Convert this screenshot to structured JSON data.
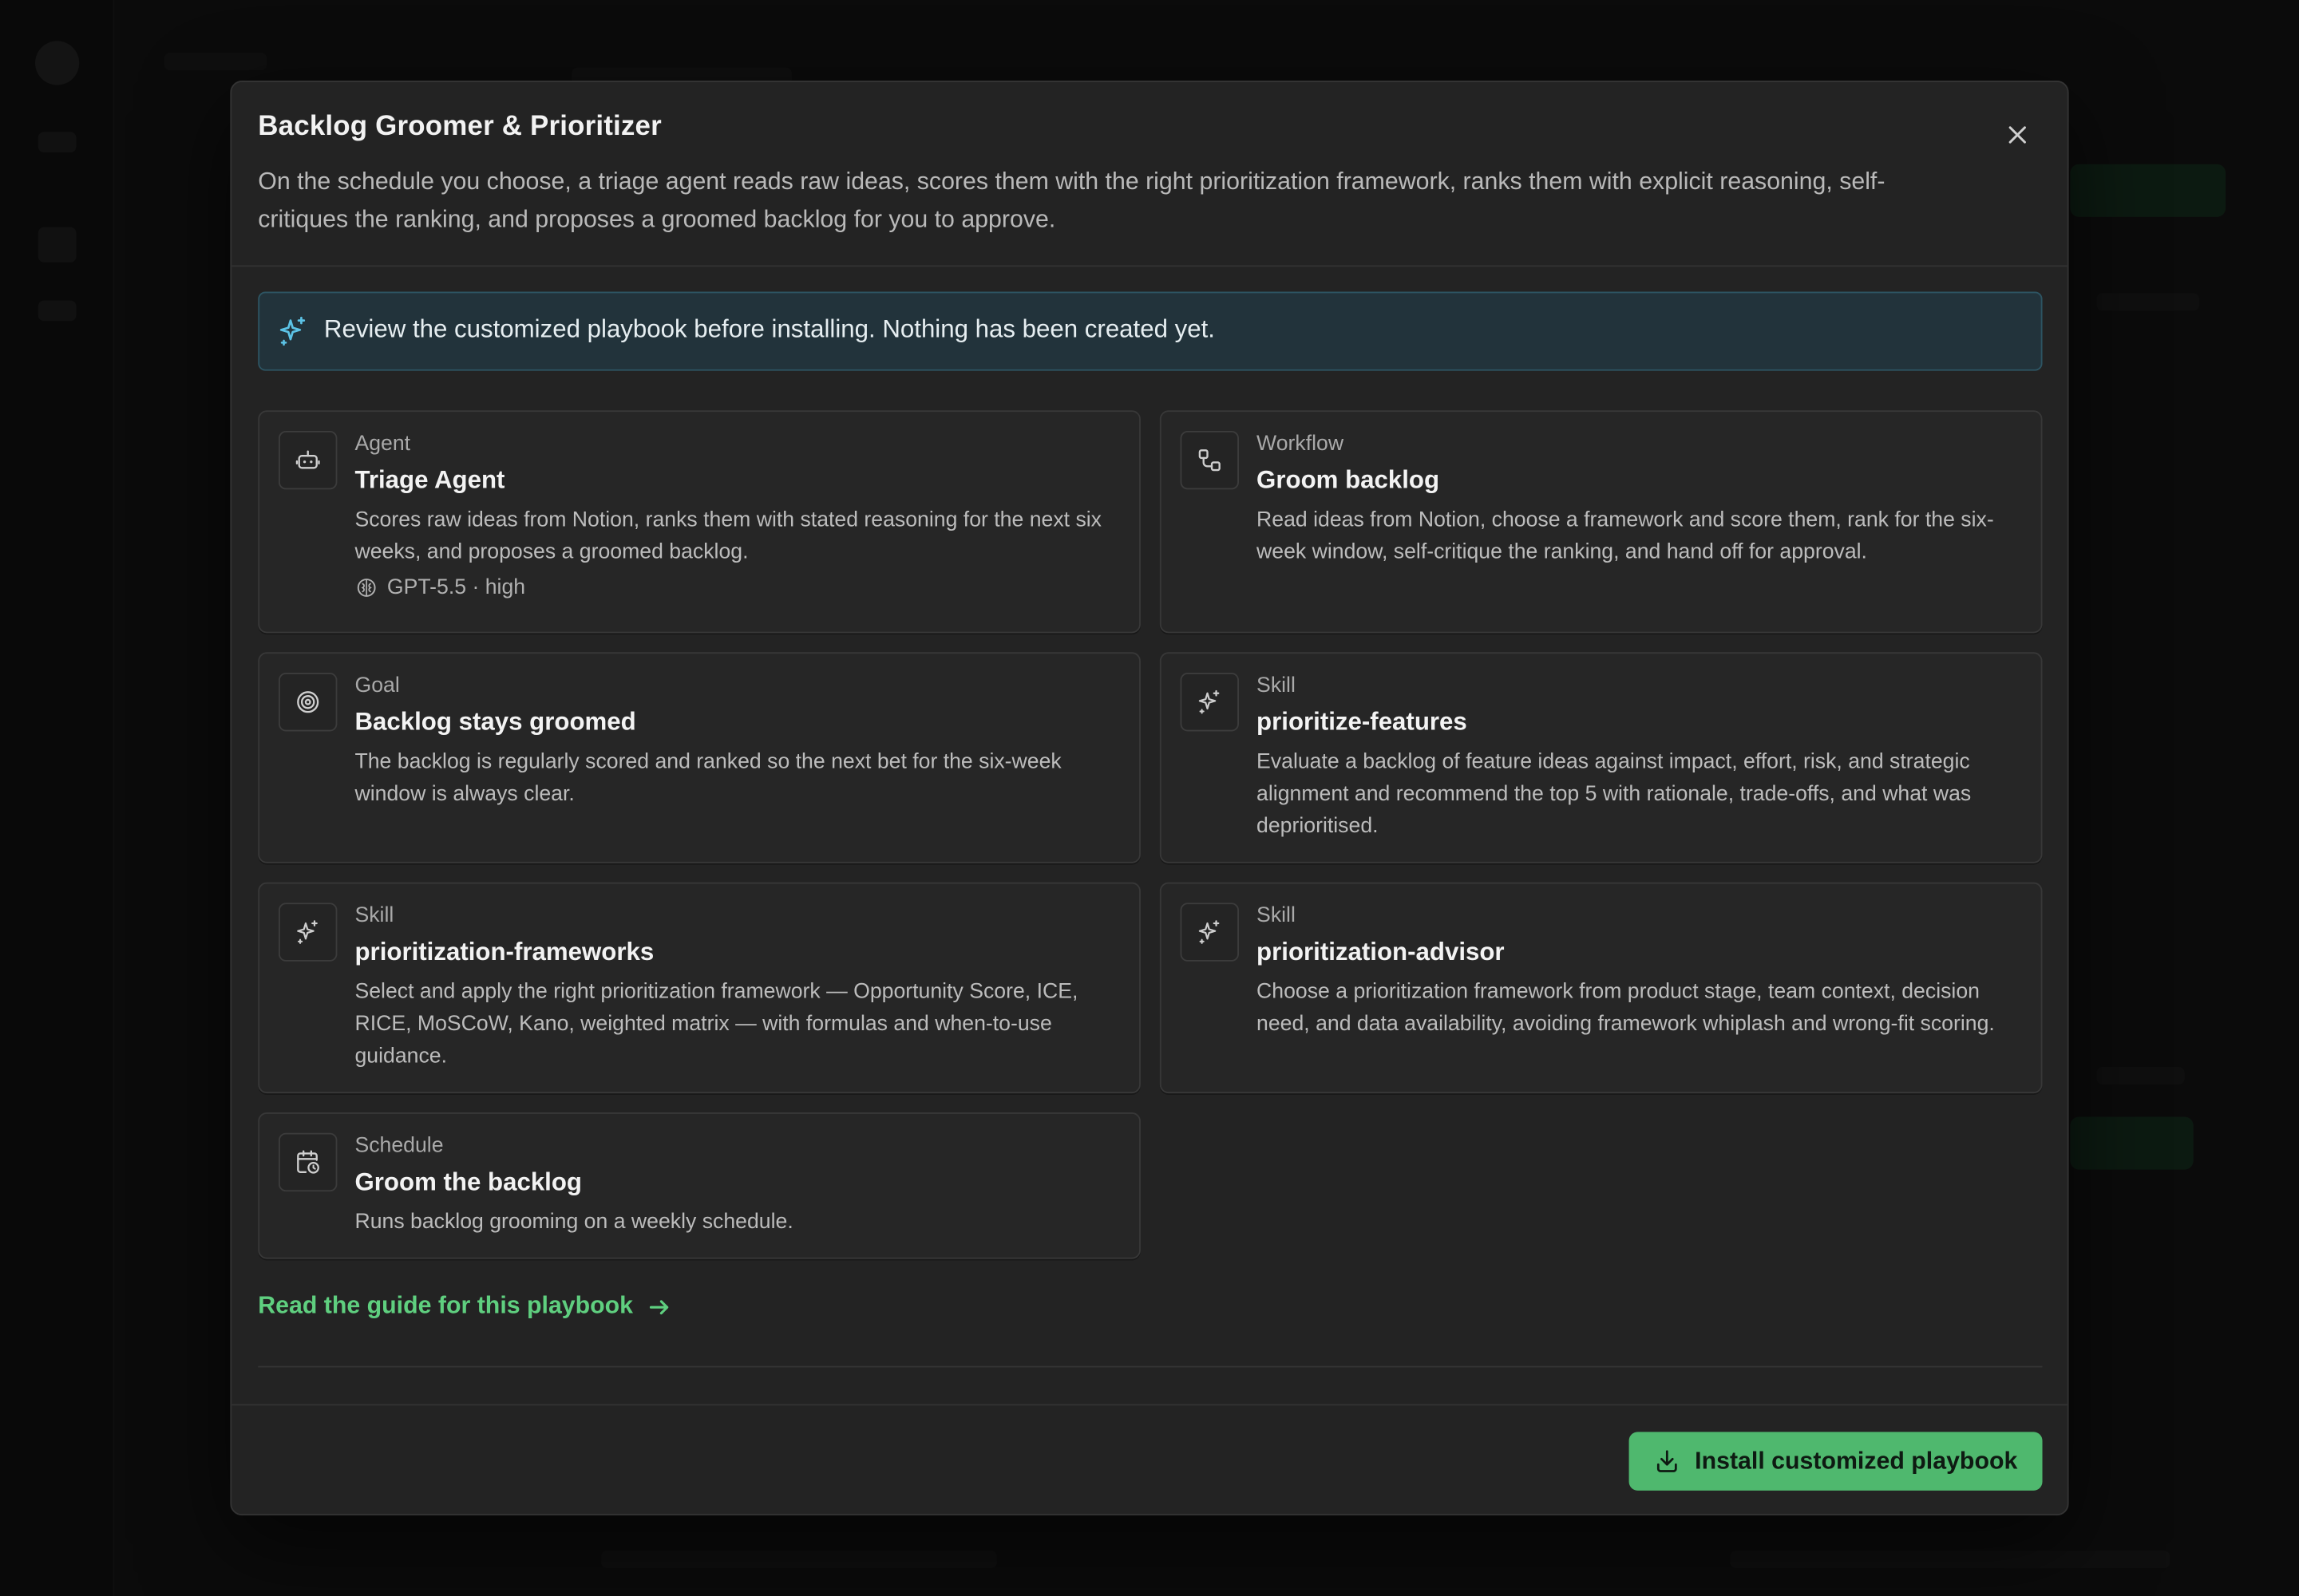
{
  "modal": {
    "title": "Backlog Groomer & Prioritizer",
    "description": "On the schedule you choose, a triage agent reads raw ideas, scores them with the right prioritization framework, ranks them with explicit reasoning, self-critiques the ranking, and proposes a groomed backlog for you to approve.",
    "close_icon": "close-icon"
  },
  "notice": {
    "icon": "sparkles-icon",
    "text": "Review the customized playbook before installing. Nothing has been created yet."
  },
  "cards": [
    {
      "kind": "Agent",
      "title": "Triage Agent",
      "description": "Scores raw ideas from Notion, ranks them with stated reasoning for the next six weeks, and proposes a groomed backlog.",
      "model": "GPT-5.5 · high",
      "icon": "robot-icon"
    },
    {
      "kind": "Workflow",
      "title": "Groom backlog",
      "description": "Read ideas from Notion, choose a framework and score them, rank for the six-week window, self-critique the ranking, and hand off for approval.",
      "icon": "workflow-icon"
    },
    {
      "kind": "Goal",
      "title": "Backlog stays groomed",
      "description": "The backlog is regularly scored and ranked so the next bet for the six-week window is always clear.",
      "icon": "target-icon"
    },
    {
      "kind": "Skill",
      "title": "prioritize-features",
      "description": "Evaluate a backlog of feature ideas against impact, effort, risk, and strategic alignment and recommend the top 5 with rationale, trade-offs, and what was deprioritised.",
      "icon": "sparkles-icon"
    },
    {
      "kind": "Skill",
      "title": "prioritization-frameworks",
      "description": "Select and apply the right prioritization framework — Opportunity Score, ICE, RICE, MoSCoW, Kano, weighted matrix — with formulas and when-to-use guidance.",
      "icon": "sparkles-icon"
    },
    {
      "kind": "Skill",
      "title": "prioritization-advisor",
      "description": "Choose a prioritization framework from product stage, team context, decision need, and data availability, avoiding framework whiplash and wrong-fit scoring.",
      "icon": "sparkles-icon"
    },
    {
      "kind": "Schedule",
      "title": "Groom the backlog",
      "description": "Runs backlog grooming on a weekly schedule.",
      "icon": "calendar-clock-icon"
    }
  ],
  "guide_link": {
    "label": "Read the guide for this playbook",
    "icon": "arrow-right-icon"
  },
  "install_button": {
    "label": "Install customized playbook",
    "icon": "download-icon"
  },
  "colors": {
    "accent": "#4fb86e",
    "link": "#5fcf7f",
    "notice_bg": "#22333b",
    "modal_bg": "#232323"
  }
}
